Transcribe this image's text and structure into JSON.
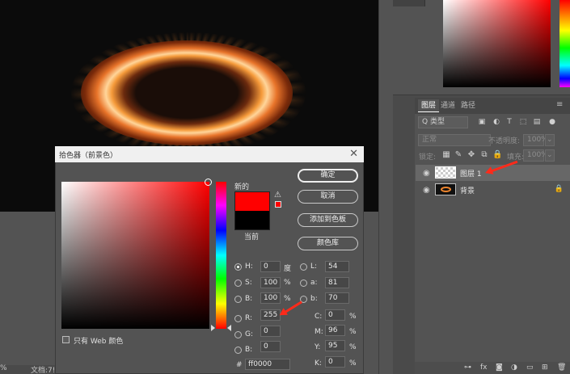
{
  "canvas": {
    "status_zoom": "%",
    "status_doc": "文档:7!"
  },
  "dialog": {
    "title": "拾色器（前景色）",
    "close": "✕",
    "new_label": "新的",
    "current_label": "当前",
    "new_color": "#ff0000",
    "current_color": "#000000",
    "buttons": {
      "ok": "确定",
      "cancel": "取消",
      "add_to_swatches": "添加到色板",
      "color_libraries": "颜色库"
    },
    "only_web_colors": "只有 Web 颜色",
    "hsb": {
      "h_label": "H:",
      "h_value": "0",
      "h_unit": "度",
      "s_label": "S:",
      "s_value": "100",
      "s_unit": "%",
      "b_label": "B:",
      "b_value": "100",
      "b_unit": "%"
    },
    "rgb": {
      "r_label": "R:",
      "r_value": "255",
      "g_label": "G:",
      "g_value": "0",
      "b_label": "B:",
      "b_value": "0"
    },
    "lab": {
      "l_label": "L:",
      "l_value": "54",
      "a_label": "a:",
      "a_value": "81",
      "b_label": "b:",
      "b_value": "70"
    },
    "cmyk": {
      "c_label": "C:",
      "c_value": "0",
      "c_unit": "%",
      "m_label": "M:",
      "m_value": "96",
      "m_unit": "%",
      "y_label": "Y:",
      "y_value": "95",
      "y_unit": "%",
      "k_label": "K:",
      "k_value": "0",
      "k_unit": "%"
    },
    "hex_label": "#",
    "hex_value": "ff0000"
  },
  "layers_panel": {
    "tabs": [
      "图层",
      "通道",
      "路径"
    ],
    "filter_kind": "Q 类型",
    "blend_mode": "正常",
    "opacity_label": "不透明度:",
    "opacity_value": "100%",
    "lock_label": "锁定:",
    "fill_label": "填充:",
    "fill_value": "100%",
    "layers": [
      {
        "name": "图层 1",
        "selected": true
      },
      {
        "name": "背景",
        "selected": false
      }
    ]
  }
}
